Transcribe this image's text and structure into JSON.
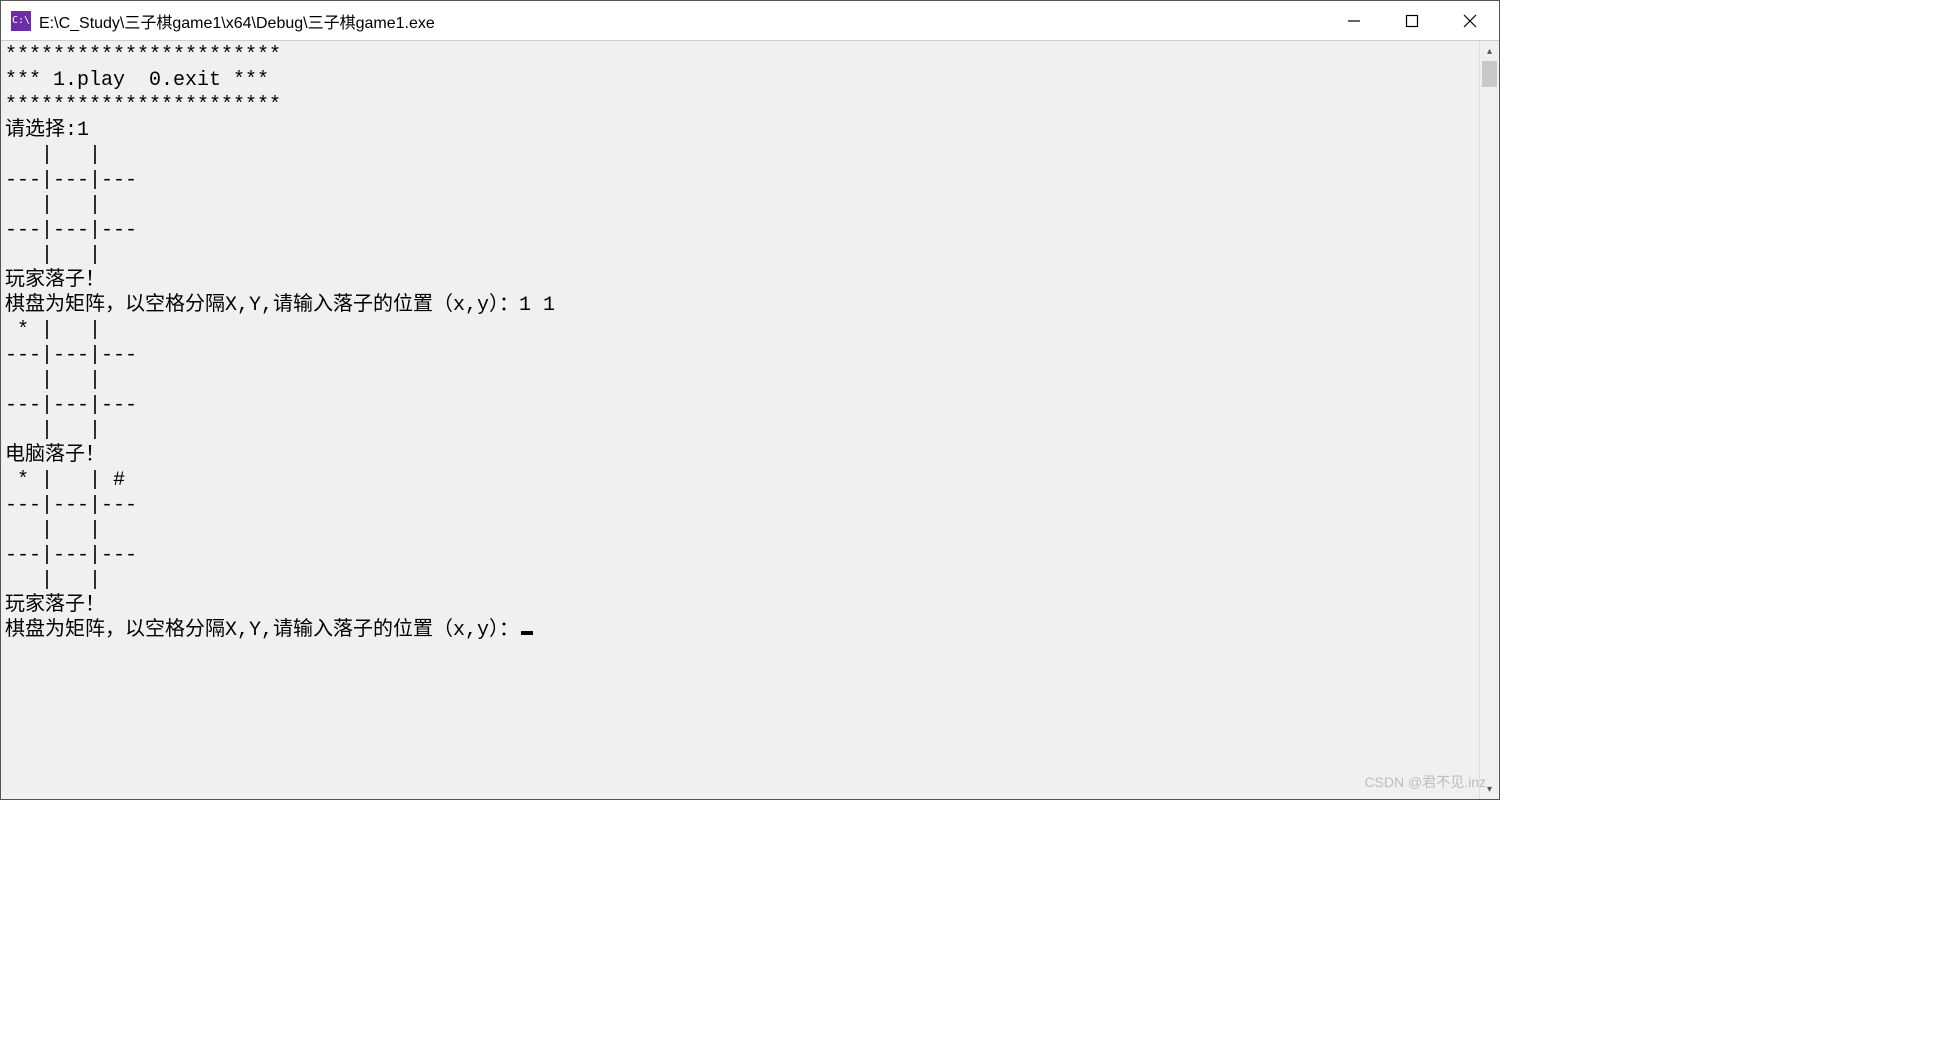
{
  "titlebar": {
    "icon_label": "C:\\",
    "title": "E:\\C_Study\\三子棋game1\\x64\\Debug\\三子棋game1.exe"
  },
  "console": {
    "lines": [
      "***********************",
      "*** 1.play  0.exit ***",
      "***********************",
      "请选择:1",
      "   |   |   ",
      "---|---|---",
      "   |   |   ",
      "---|---|---",
      "   |   |   ",
      "玩家落子！",
      "棋盘为矩阵，以空格分隔X,Y,请输入落子的位置（x,y）：1 1",
      " * |   |   ",
      "---|---|---",
      "   |   |   ",
      "---|---|---",
      "   |   |   ",
      "电脑落子！",
      " * |   | # ",
      "---|---|---",
      "   |   |   ",
      "---|---|---",
      "   |   |   ",
      "玩家落子！",
      "棋盘为矩阵，以空格分隔X,Y,请输入落子的位置（x,y）："
    ]
  },
  "watermark": "CSDN @君不见.inz"
}
